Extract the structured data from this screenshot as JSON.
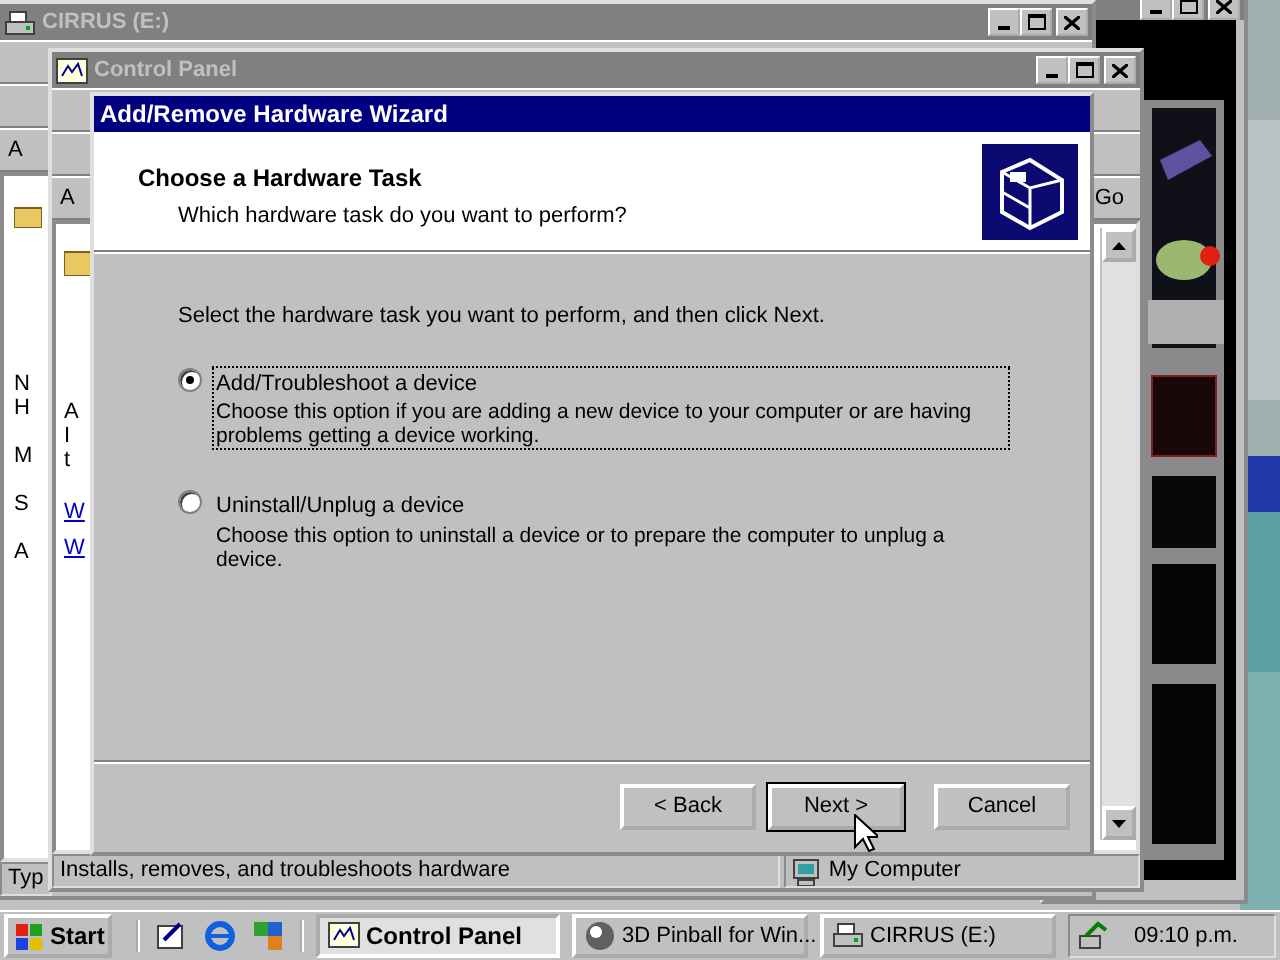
{
  "cirrus_window": {
    "title": "CIRRUS (E:)",
    "address_fragment": "A",
    "side_fragments": [
      "N",
      "H",
      "M",
      "S",
      "A"
    ],
    "status_fragment": "Typ"
  },
  "control_panel": {
    "title": "Control Panel",
    "address_fragment": "A",
    "go_button": "Go",
    "side_fragments": [
      "A",
      "I",
      "t"
    ],
    "links": [
      "W",
      "W"
    ],
    "status_text": "Installs, removes, and troubleshoots hardware",
    "status_zone": "My Computer"
  },
  "wizard": {
    "title": "Add/Remove Hardware Wizard",
    "heading": "Choose a Hardware Task",
    "subheading": "Which hardware task do you want to perform?",
    "instruction": "Select the hardware task you want to perform, and then click Next.",
    "options": [
      {
        "label": "Add/Troubleshoot a device",
        "description": "Choose this option if you are adding a new device to your computer or are having problems getting a device working.",
        "selected": true
      },
      {
        "label": "Uninstall/Unplug a device",
        "description": "Choose this option to uninstall a device or to prepare the computer to unplug a device.",
        "selected": false
      }
    ],
    "buttons": [
      {
        "label": "< Back",
        "kind": "back"
      },
      {
        "label": "Next >",
        "kind": "next"
      },
      {
        "label": "Cancel",
        "kind": "cancel"
      }
    ]
  },
  "taskbar": {
    "start": "Start",
    "tasks": [
      {
        "label": "Control Panel",
        "kind": "control",
        "selected": true
      },
      {
        "label": "3D Pinball for Win...",
        "kind": "pinball",
        "selected": false
      },
      {
        "label": "CIRRUS (E:)",
        "kind": "drive",
        "selected": false
      }
    ],
    "clock": "09:10 p.m."
  }
}
